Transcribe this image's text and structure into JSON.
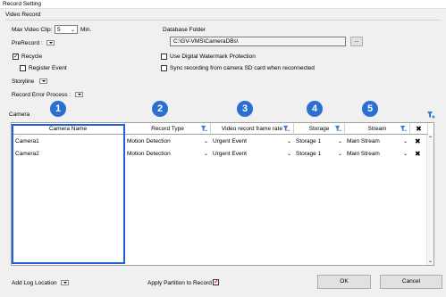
{
  "window": {
    "title": "Record Setting"
  },
  "video_record": {
    "group_label": "Video Record",
    "max_clip_label": "Max Video Clip:",
    "max_clip_value": "5",
    "max_clip_unit": "Min.",
    "prerecord_label": "PreRecord :",
    "recycle_label": "Recycle",
    "recycle_checked": true,
    "register_event_label": "Register Event",
    "storyline_label": "Storyline",
    "record_error_label": "Record Error Process :"
  },
  "database": {
    "folder_label": "Database Folder",
    "folder_path": "C:\\GV-VMS\\CameraDBs\\",
    "browse_label": "...",
    "watermark_label": "Use Digital Watermark Protection",
    "sync_label": "Sync recording from camera SD card when reconnected"
  },
  "camera": {
    "section_label": "Camera",
    "columns": [
      "Camera Name",
      "Record Type",
      "Video record frame rate",
      "Storage",
      "Stream"
    ],
    "badges": [
      "1",
      "2",
      "3",
      "4",
      "5"
    ],
    "rows": [
      {
        "name": "Camera1",
        "record_type": "Motion Detection",
        "frame_rate": "Urgent Event",
        "storage": "Storage 1",
        "stream": "Main Stream"
      },
      {
        "name": "Camera2",
        "record_type": "Motion Detection",
        "frame_rate": "Urgent Event",
        "storage": "Storage 1",
        "stream": "Main Stream"
      }
    ]
  },
  "footer": {
    "log_location_label": "Add Log Location",
    "apply_partition_label": "Apply Partition to Record",
    "ok_label": "OK",
    "cancel_label": "Cancel"
  },
  "colors": {
    "badge": "#2a6fd1",
    "highlight": "#1e63d6",
    "accent_check": "#e03030"
  }
}
